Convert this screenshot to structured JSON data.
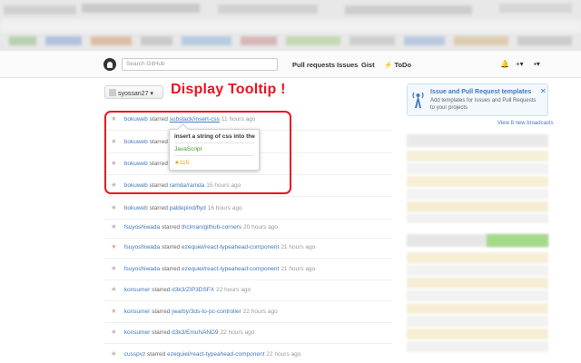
{
  "header": {
    "search_placeholder": "Search GitHub",
    "nav": [
      "Pull requests",
      "Issues",
      "Gist"
    ],
    "todo_label": "ToDo",
    "bell_icon": "bell-icon",
    "plus_icon": "plus-icon"
  },
  "context": {
    "username": "syossan27"
  },
  "callout": {
    "text": "Display Tooltip !",
    "color": "#e8141f"
  },
  "feed": [
    {
      "actor": "bokuweb",
      "verb": "starred",
      "repo": "substack/insert-css",
      "time": "11 hours ago",
      "highlight": true
    },
    {
      "actor": "bokuweb",
      "verb": "starred",
      "repo": "",
      "time": "",
      "highlight": false
    },
    {
      "actor": "bokuweb",
      "verb": "starred",
      "repo": "",
      "time": "",
      "highlight": false
    },
    {
      "actor": "bokuweb",
      "verb": "starred",
      "repo": "ramda/ramda",
      "time": "15 hours ago",
      "highlight": false
    },
    {
      "actor": "bokuweb",
      "verb": "starred",
      "repo": "paldepind/flyd",
      "time": "16 hours ago",
      "highlight": false
    },
    {
      "actor": "fsuyoshiwada",
      "verb": "starred",
      "repo": "thclman/github-corners",
      "time": "20 hours ago",
      "highlight": false
    },
    {
      "actor": "fsuyoshiwada",
      "verb": "starred",
      "repo": "ezequiel/react-typeahead-component",
      "time": "21 hours ago",
      "highlight": false
    },
    {
      "actor": "fsuyoshiwada",
      "verb": "starred",
      "repo": "ezequiel/react-typeahead-component",
      "time": "21 hours ago",
      "highlight": false
    },
    {
      "actor": "konsumer",
      "verb": "starred",
      "repo": "d3k3/ZIP3DSFX",
      "time": "22 hours ago",
      "highlight": false
    },
    {
      "actor": "konsumer",
      "verb": "starred",
      "repo": "jwarby/3ds-to-pc-controller",
      "time": "22 hours ago",
      "highlight": false
    },
    {
      "actor": "konsumer",
      "verb": "starred",
      "repo": "d3k3/EmuNAND9",
      "time": "22 hours ago",
      "highlight": false
    },
    {
      "actor": "cusspvz",
      "verb": "starred",
      "repo": "ezequiel/react-typeahead-component",
      "time": "22 hours ago",
      "highlight": false
    }
  ],
  "tooltip": {
    "description": "insert a string of css into the",
    "language": "JavaScript",
    "stars": "★115"
  },
  "notice": {
    "title": "Issue and Pull Request templates",
    "body": "Add templates for Issues and Pull Requests to your projects",
    "broadcasts": "View 8 new broadcasts",
    "close_icon": "close-icon"
  }
}
